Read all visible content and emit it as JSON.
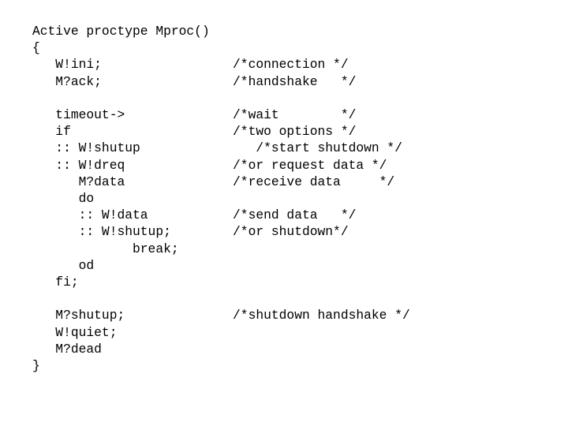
{
  "slide": {
    "background_color": "#ffffff",
    "text_color": "#000000",
    "language": "Promela",
    "comment_column": 27
  },
  "code": {
    "lines": [
      "Active proctype Mproc()",
      "{",
      "   W!ini;                 /*connection */",
      "   M?ack;                 /*handshake   */",
      "",
      "   timeout->              /*wait        */",
      "   if                     /*two options */",
      "   :: W!shutup               /*start shutdown */",
      "   :: W!dreq              /*or request data */",
      "      M?data              /*receive data     */",
      "      do",
      "      :: W!data           /*send data   */",
      "      :: W!shutup;        /*or shutdown*/",
      "             break;",
      "      od",
      "   fi;",
      "",
      "   M?shutup;              /*shutdown handshake */",
      "   W!quiet;",
      "   M?dead",
      "}"
    ],
    "line_count": 21
  }
}
